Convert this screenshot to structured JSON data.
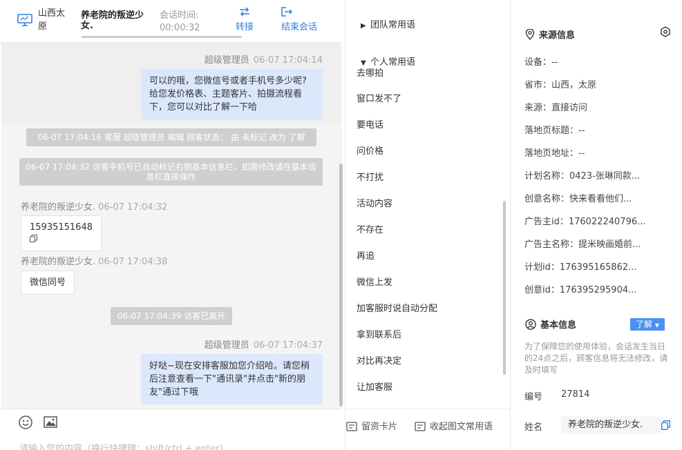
{
  "topbar": {
    "location": "山西太原",
    "visitor_name": "养老院的叛逆少女.",
    "session_time_label": "会话时间:",
    "session_time_value": "00:00:32",
    "transfer_label": "转接",
    "end_label": "结束会话"
  },
  "messages": {
    "m1_sender": "超级管理员",
    "m1_time": "06-07 17:04:14",
    "m1_text": "可以的哦，您微信号或者手机号多少呢?给您发价格表、主题客片、拍摄流程看下，您可以对比了解一下哈",
    "sys1": "06-07 17:04:16 客服 超级管理员 编辑 顾客状态： 由 未标记 改为 了解",
    "sys2": "06-07 17:04:32 访客手机号已自动标记右侧基本信息栏，如需修改请在基本信息栏直接操作",
    "m2_sender": "养老院的叛逆少女.",
    "m2_time": "06-07 17:04:32",
    "m2_text": "15935151648",
    "m3_sender": "养老院的叛逆少女.",
    "m3_time": "06-07 17:04:38",
    "m3_text": "微信同号",
    "sys3": "06-07 17:04:39 访客已离开",
    "m4_sender": "超级管理员",
    "m4_time": "06-07 17:04:37",
    "m4_text": "好哒~现在安排客服加您介绍哈。请您稍后注意查看一下\"通讯录\"并点击\"新的朋友\"通过下哦"
  },
  "composer": {
    "placeholder": "请输入您的内容（换行快捷键：shift/ctrl + enter)"
  },
  "phrases": {
    "team_group": "团队常用语",
    "personal_group": "个人常用语",
    "items": [
      "去哪拍",
      "窗口发不了",
      "要电话",
      "问价格",
      "不打扰",
      "活动内容",
      "不存在",
      "再追",
      "微信上发",
      "加客服时说自动分配",
      "拿到联系后",
      "对比再决定",
      "让加客服"
    ],
    "card_btn": "留资卡片",
    "collapse_btn": "收起图文常用语"
  },
  "source": {
    "title": "来源信息",
    "rows": [
      "设备：--",
      "省市：山西，太原",
      "来源：直接访问",
      "落地页标题：--",
      "落地页地址：--",
      "计划名称：0423-张琳同款...",
      "创意名称：快来看看他们...",
      "广告主id：176022240796...",
      "广告主名称：提米映画婚前...",
      "计划id：176395165862...",
      "创意id：176395295904..."
    ]
  },
  "basic": {
    "title": "基本信息",
    "status_badge": "了解",
    "notice": "为了保障您的使用体验，会话发生当日的24点之后，顾客信息将无法修改，请及时填写",
    "id_label": "编号",
    "id_value": "27814",
    "name_label": "姓名",
    "name_value": "养老院的叛逆少女."
  }
}
